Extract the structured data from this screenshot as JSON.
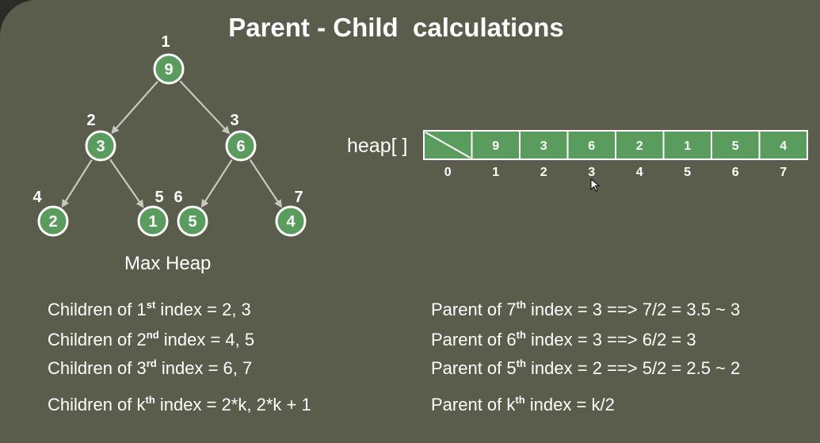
{
  "title": "Parent - Child  calculations",
  "tree": {
    "nodes": [
      {
        "index": "1",
        "value": "9"
      },
      {
        "index": "2",
        "value": "3"
      },
      {
        "index": "3",
        "value": "6"
      },
      {
        "index": "4",
        "value": "2"
      },
      {
        "index": "5",
        "value": "1"
      },
      {
        "index": "6",
        "value": "5"
      },
      {
        "index": "7",
        "value": "4"
      }
    ],
    "caption": "Max Heap"
  },
  "array": {
    "label": "heap[ ]",
    "cells": [
      "",
      "9",
      "3",
      "6",
      "2",
      "1",
      "5",
      "4"
    ],
    "indices": [
      "0",
      "1",
      "2",
      "3",
      "4",
      "5",
      "6",
      "7"
    ]
  },
  "children": [
    {
      "prefix": "Children of 1",
      "sup": "st",
      "suffix": " index = 2, 3"
    },
    {
      "prefix": "Children of 2",
      "sup": "nd",
      "suffix": " index = 4, 5"
    },
    {
      "prefix": "Children of 3",
      "sup": "rd",
      "suffix": " index = 6, 7"
    },
    {
      "prefix": "Children of k",
      "sup": "th",
      "suffix": " index = 2*k, 2*k + 1"
    }
  ],
  "parents": [
    {
      "prefix": "Parent of 7",
      "sup": "th",
      "suffix": " index = 3 ==> 7/2 = 3.5 ~ 3"
    },
    {
      "prefix": "Parent of 6",
      "sup": "th",
      "suffix": " index = 3 ==> 6/2 = 3"
    },
    {
      "prefix": "Parent of 5",
      "sup": "th",
      "suffix": " index = 2 ==> 5/2 = 2.5 ~ 2"
    },
    {
      "prefix": "Parent of k",
      "sup": "th",
      "suffix": " index = k/2"
    }
  ]
}
